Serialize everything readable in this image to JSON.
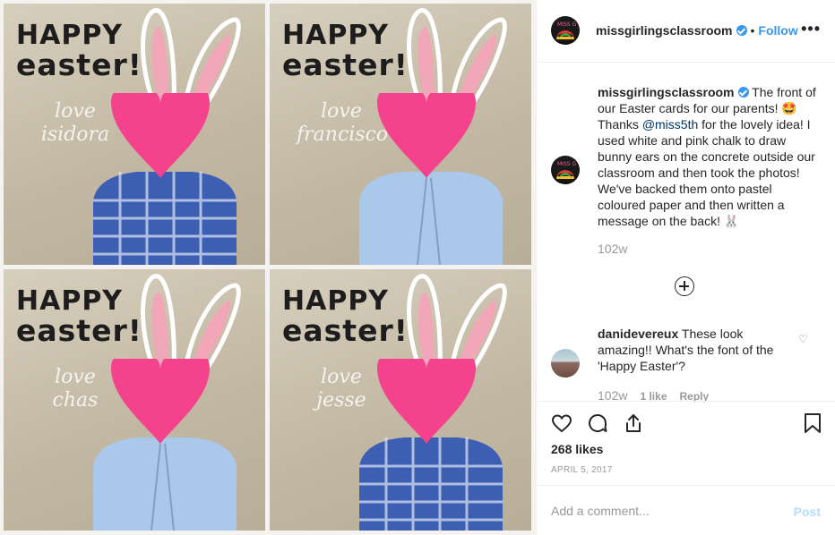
{
  "tiles": [
    {
      "happy_line1": "HAPPY",
      "happy_line2": "easter!",
      "love": "love",
      "name": "isidora",
      "shirt": "#3c5fb4"
    },
    {
      "happy_line1": "HAPPY",
      "happy_line2": "easter!",
      "love": "love",
      "name": "francisco",
      "shirt": "#a9c8ea"
    },
    {
      "happy_line1": "HAPPY",
      "happy_line2": "easter!",
      "love": "love",
      "name": "chas",
      "shirt": "#a9c8ea"
    },
    {
      "happy_line1": "HAPPY",
      "happy_line2": "easter!",
      "love": "love",
      "name": "jesse",
      "shirt": "#3c5fb4"
    }
  ],
  "colors": {
    "heart": "#f4428c",
    "ear_inner": "#f2a7b9",
    "link": "#3897f0",
    "post_disabled": "#b2dffc"
  },
  "header": {
    "username": "missgirlingsclassroom",
    "separator": "•",
    "follow": "Follow",
    "more": "•••"
  },
  "caption": {
    "username": "missgirlingsclassroom",
    "text1": " The front of our Easter cards for our parents! 🤩 Thanks ",
    "mention": "@miss5th",
    "text2": " for the lovely idea! I used white and pink chalk to draw bunny ears on the concrete outside our classroom and then took the photos! We've backed them onto pastel coloured paper and then written a message on the back! 🐰",
    "time": "102w"
  },
  "comment": {
    "username": "danidevereux",
    "text": " These look amazing!! What's the font of the 'Happy Easter'?",
    "time": "102w",
    "likes": "1 like",
    "reply": "Reply"
  },
  "likes": "268 likes",
  "date": "APRIL 5, 2017",
  "add_comment": {
    "placeholder": "Add a comment...",
    "post": "Post"
  }
}
